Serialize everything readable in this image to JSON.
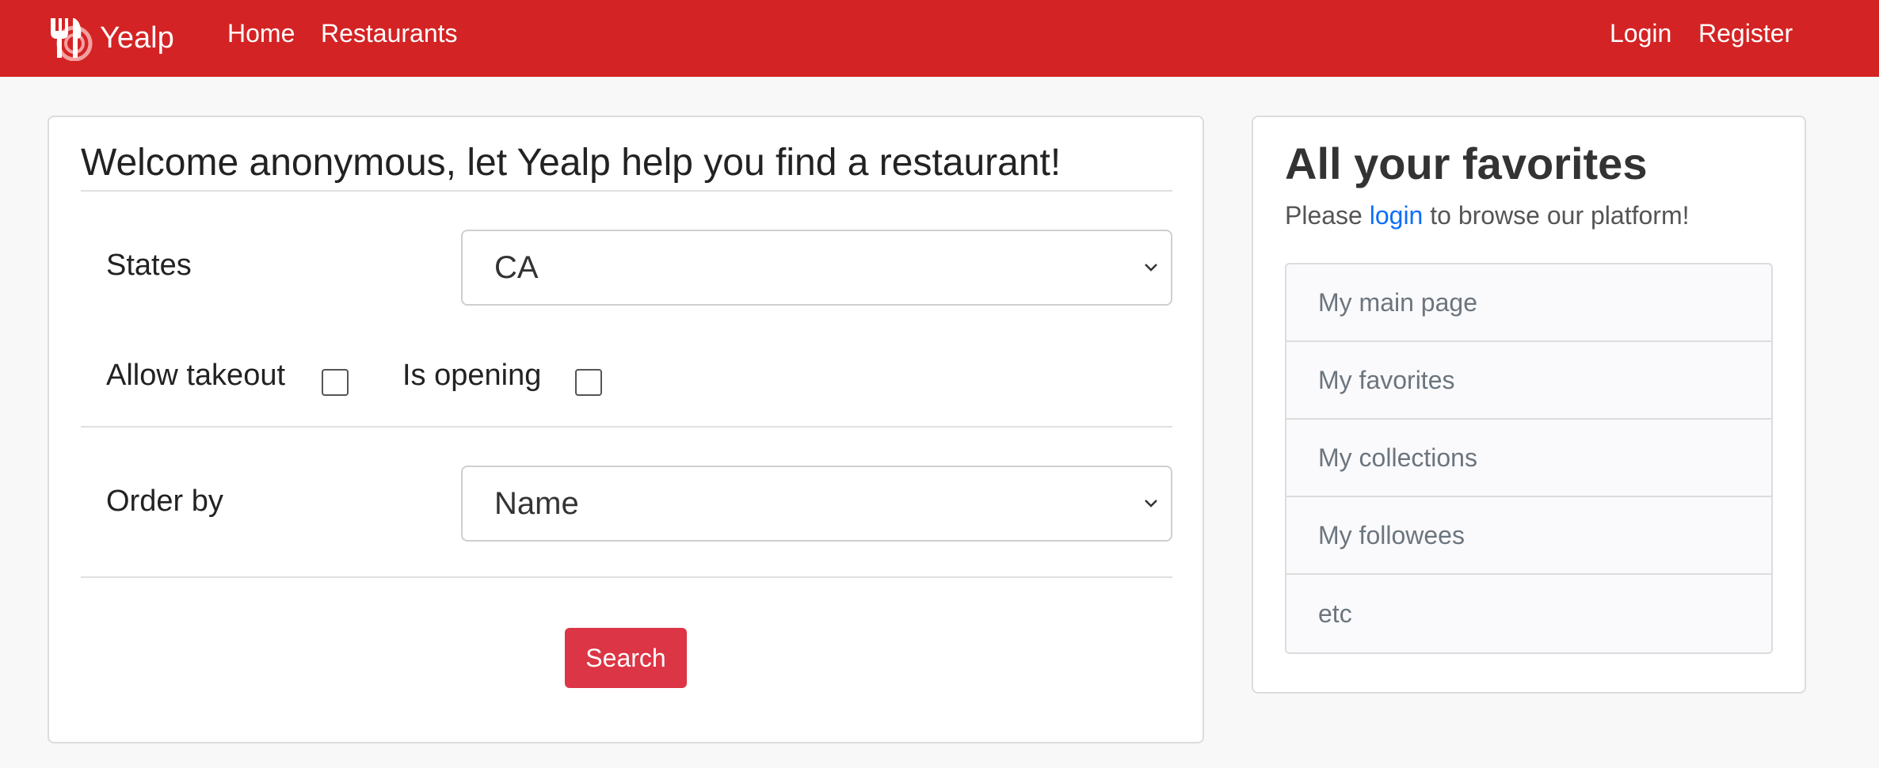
{
  "navbar": {
    "brand_name": "Yealp",
    "brand_icon": "restaurant-logo-icon",
    "links": [
      "Home",
      "Restaurants"
    ],
    "auth_links": [
      "Login",
      "Register"
    ],
    "background_color": "#d42324"
  },
  "search_card": {
    "title": "Welcome anonymous, let Yealp help you find a restaurant!",
    "states_label": "States",
    "states_value": "CA",
    "takeout_label": "Allow takeout",
    "takeout_checked": false,
    "opening_label": "Is opening",
    "opening_checked": false,
    "order_label": "Order by",
    "order_value": "Name",
    "search_button": "Search",
    "button_color": "#dc3545"
  },
  "favorites_card": {
    "title": "All your favorites",
    "subtitle_before": "Please ",
    "subtitle_link": "login",
    "subtitle_after": " to browse our platform!",
    "items": [
      "My main page",
      "My favorites",
      "My collections",
      "My followees",
      "etc"
    ]
  }
}
